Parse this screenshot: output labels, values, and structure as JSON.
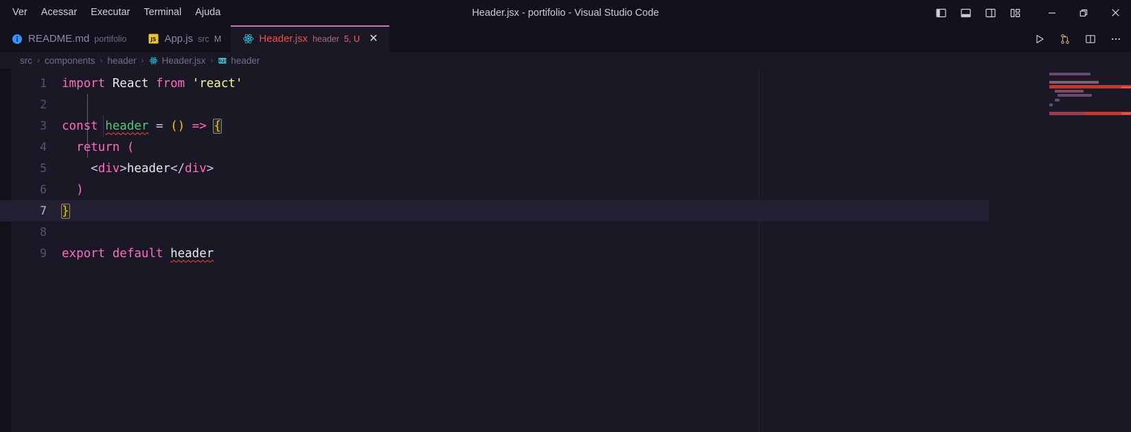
{
  "window": {
    "title": "Header.jsx - portifolio - Visual Studio Code",
    "menu": [
      "Ver",
      "Acessar",
      "Executar",
      "Terminal",
      "Ajuda"
    ],
    "layout_icons": [
      "toggle-primary-sidebar-icon",
      "toggle-panel-icon",
      "toggle-secondary-sidebar-icon",
      "customize-layout-icon"
    ],
    "controls": [
      "minimize-button",
      "restore-button",
      "close-button"
    ]
  },
  "tabs": [
    {
      "label": "README.md",
      "description": "portifolio",
      "badge": "",
      "icon": "markdown-info-icon",
      "active": false,
      "closeable": false
    },
    {
      "label": "App.js",
      "description": "src",
      "badge": "M",
      "icon": "javascript-icon",
      "active": false,
      "closeable": false
    },
    {
      "label": "Header.jsx",
      "description": "header",
      "badge": "5, U",
      "icon": "react-icon",
      "active": true,
      "closeable": true,
      "close_label": "✕"
    }
  ],
  "tab_actions": [
    "run-button",
    "source-control-icon",
    "split-editor-button",
    "more-actions-button"
  ],
  "breadcrumb": [
    {
      "label": "src",
      "icon": ""
    },
    {
      "label": "components",
      "icon": ""
    },
    {
      "label": "header",
      "icon": ""
    },
    {
      "label": "Header.jsx",
      "icon": "react-icon"
    },
    {
      "label": "header",
      "icon": "symbol-variable-icon"
    }
  ],
  "breadcrumb_separator": "›",
  "editor": {
    "current_line": 7,
    "lines": [
      {
        "n": "1",
        "tokens": [
          {
            "t": "import",
            "c": "t-kw"
          },
          {
            "t": " ",
            "c": "t-plain"
          },
          {
            "t": "React",
            "c": "t-ident"
          },
          {
            "t": " ",
            "c": "t-plain"
          },
          {
            "t": "from",
            "c": "t-kw"
          },
          {
            "t": " ",
            "c": "t-plain"
          },
          {
            "t": "'react'",
            "c": "t-str"
          }
        ]
      },
      {
        "n": "2",
        "tokens": []
      },
      {
        "n": "3",
        "tokens": [
          {
            "t": "const",
            "c": "t-kw"
          },
          {
            "t": " ",
            "c": "t-plain"
          },
          {
            "t": "header",
            "c": "t-fn squiggle"
          },
          {
            "t": " ",
            "c": "t-plain"
          },
          {
            "t": "=",
            "c": "t-punct"
          },
          {
            "t": " ",
            "c": "t-plain"
          },
          {
            "t": "()",
            "c": "t-paren"
          },
          {
            "t": " ",
            "c": "t-plain"
          },
          {
            "t": "=>",
            "c": "t-arrow"
          },
          {
            "t": " ",
            "c": "t-plain"
          },
          {
            "t": "{",
            "c": "t-paren bracket-match"
          }
        ]
      },
      {
        "n": "4",
        "tokens": [
          {
            "t": "  ",
            "c": "t-plain"
          },
          {
            "t": "return",
            "c": "t-kw"
          },
          {
            "t": " ",
            "c": "t-plain"
          },
          {
            "t": "(",
            "c": "t-tag"
          }
        ]
      },
      {
        "n": "5",
        "tokens": [
          {
            "t": "    ",
            "c": "t-plain"
          },
          {
            "t": "<",
            "c": "t-brk"
          },
          {
            "t": "div",
            "c": "t-tag"
          },
          {
            "t": ">",
            "c": "t-brk"
          },
          {
            "t": "header",
            "c": "t-text"
          },
          {
            "t": "<",
            "c": "t-brk"
          },
          {
            "t": "/",
            "c": "t-brk"
          },
          {
            "t": "div",
            "c": "t-tag"
          },
          {
            "t": ">",
            "c": "t-brk"
          }
        ]
      },
      {
        "n": "6",
        "tokens": [
          {
            "t": "  ",
            "c": "t-plain"
          },
          {
            "t": ")",
            "c": "t-tag"
          }
        ]
      },
      {
        "n": "7",
        "tokens": [
          {
            "t": "}",
            "c": "t-paren bracket-match"
          }
        ]
      },
      {
        "n": "8",
        "tokens": []
      },
      {
        "n": "9",
        "tokens": [
          {
            "t": "export",
            "c": "t-kw"
          },
          {
            "t": " ",
            "c": "t-plain"
          },
          {
            "t": "default",
            "c": "t-kw"
          },
          {
            "t": " ",
            "c": "t-plain"
          },
          {
            "t": "header",
            "c": "t-ident squiggle"
          }
        ]
      }
    ]
  },
  "colors": {
    "titlebar_bg": "#13111b",
    "editor_bg": "#1b1825",
    "active_tab_accent": "#c678c0",
    "error": "#f14c4c",
    "keyword": "#ff6ac1",
    "string": "#f1fa8c",
    "function": "#50c878",
    "bracket": "#f1c40f",
    "linenumber": "#585374",
    "current_line_bg": "#241f33"
  }
}
